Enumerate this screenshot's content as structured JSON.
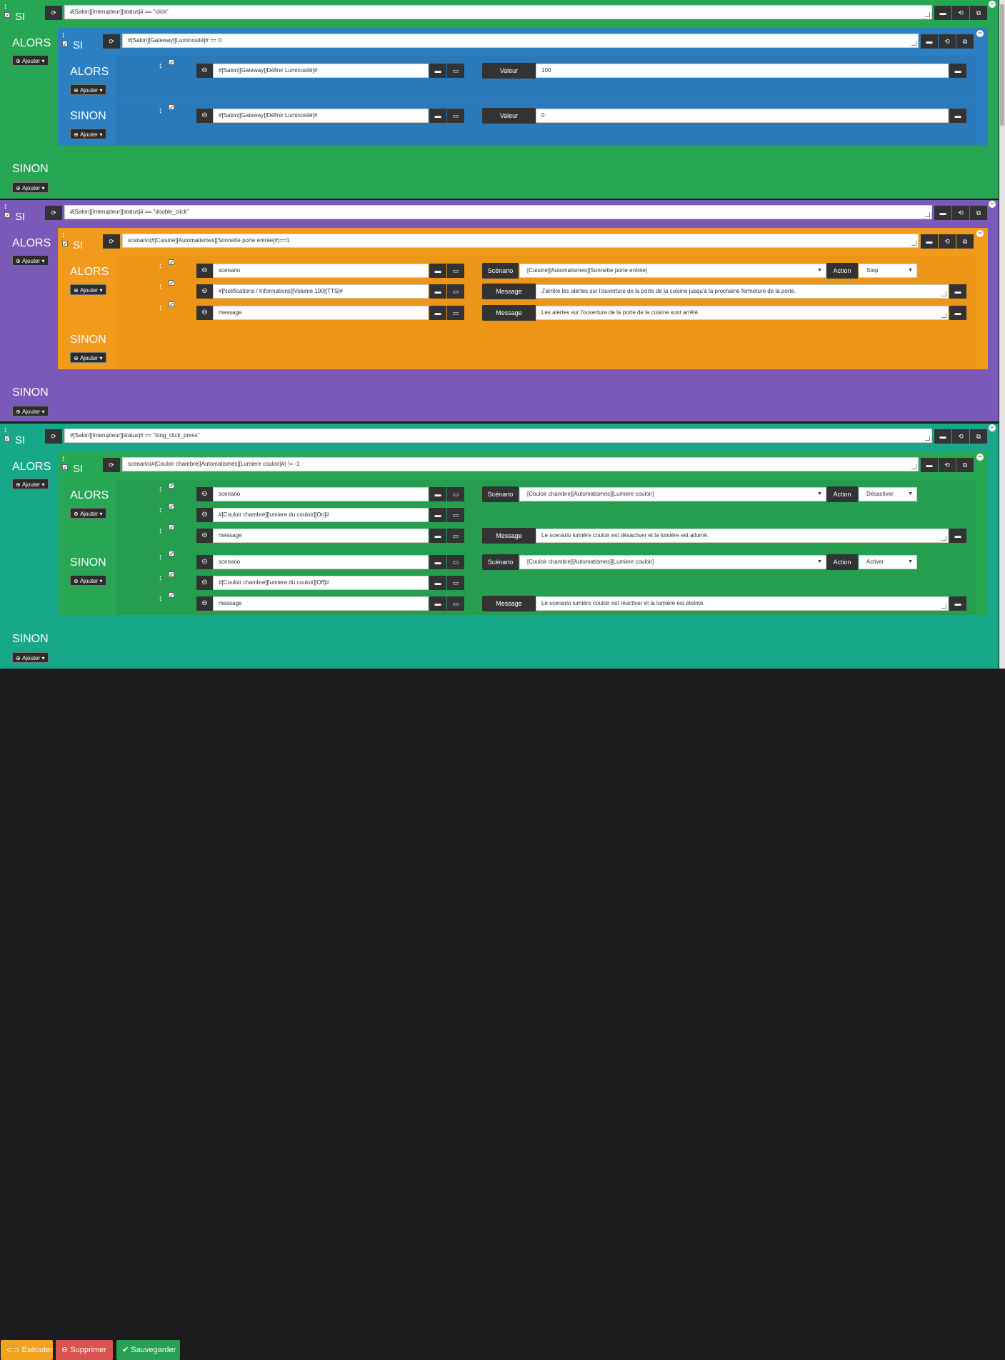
{
  "colors": {
    "green": "#27a654",
    "purple": "#7a59b8",
    "teal": "#16a889",
    "blue": "#2c80c2",
    "orange": "#f19a1c",
    "dark": "#333333"
  },
  "labels": {
    "si": "SI",
    "alors": "ALORS",
    "sinon": "SINON",
    "ajouter": "Ajouter"
  },
  "blocks": [
    {
      "condition": "#[Salon][Interupteur][status]# == \"click\"",
      "nested": {
        "condition": "#[Salon][Gateway][Luminosité]# == 0",
        "then": [
          {
            "cmd": "#[Salon][Gateway][Définir Luminosité]#",
            "tag": "Valeur",
            "value": "100"
          }
        ],
        "else": [
          {
            "cmd": "#[Salon][Gateway][Définir Luminosité]#",
            "tag": "Valeur",
            "value": "0"
          }
        ]
      }
    },
    {
      "condition": "#[Salon][Interupteur][status]# == \"double_click\"",
      "nested": {
        "condition": "scenario(#[Cuisine][Automatismes][Sonnette porte entrée]#)==1",
        "then": [
          {
            "cmd": "scenario",
            "tag": "Scénario",
            "scenario": "[Cuisine][Automatismes][Sonnette porte entrée]",
            "action_label": "Action",
            "action": "Stop"
          },
          {
            "cmd": "#[Notifications / Informations][Volume 100][TTS]#",
            "tag": "Message",
            "value": "J'arrête les alertes sur l'ouverture de la porte de la cuisine jusqu'à la prochaine fermeture de la porte."
          },
          {
            "cmd": "message",
            "tag": "Message",
            "value": "Les alertes sur l'ouverture de la porte de la cuisine sont arrêté."
          }
        ]
      }
    },
    {
      "condition": "#[Salon][Interupteur][status]# == \"long_click_press\"",
      "nested": {
        "condition": "scenario(#[Couloir chambre][Automatismes][Lumiere couloir]#) != -1",
        "then": [
          {
            "cmd": "scenario",
            "tag": "Scénario",
            "scenario": "[Couloir chambre][Automatismes][Lumiere couloir]",
            "action_label": "Action",
            "action": "Désactiver"
          },
          {
            "cmd": "#[Couloir chambre][lumiere du couloir][On]#"
          },
          {
            "cmd": "message",
            "tag": "Message",
            "value": "Le scenario lumière couloir est désactiver et la lumière est allumé."
          }
        ],
        "else": [
          {
            "cmd": "scenario",
            "tag": "Scénario",
            "scenario": "[Couloir chambre][Automatismes][Lumiere couloir]",
            "action_label": "Action",
            "action": "Activer"
          },
          {
            "cmd": "#[Couloir chambre][lumiere du couloir][Off]#"
          },
          {
            "cmd": "message",
            "tag": "Message",
            "value": "Le scenario lumière couloir est réactiver et la lumière est éteinte."
          }
        ]
      }
    }
  ],
  "footer": {
    "execute": "Exécuter",
    "delete": "Supprimer",
    "save": "Sauvegarder"
  }
}
